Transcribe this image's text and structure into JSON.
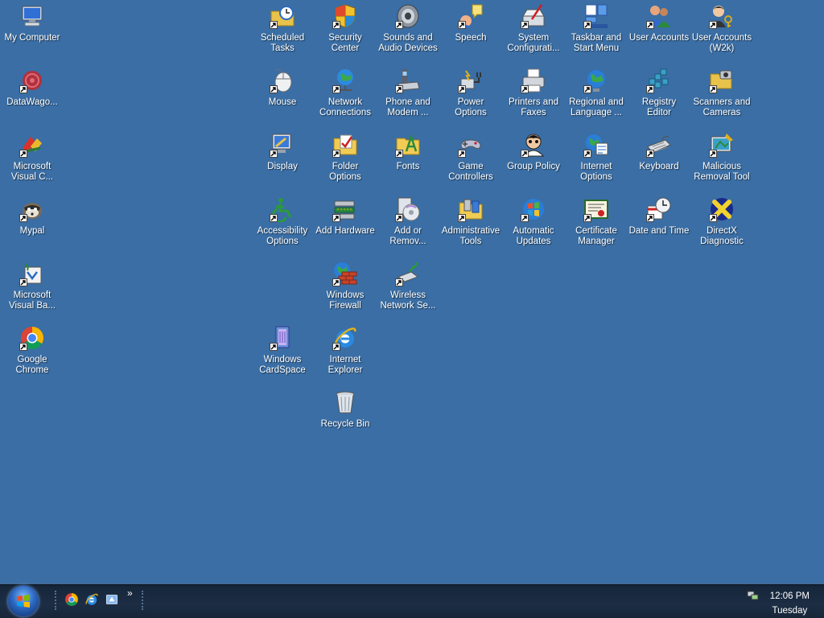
{
  "desktop_icons": [
    {
      "label": "My Computer",
      "icon": "computer-icon",
      "shortcut": false
    },
    {
      "label": "DataWago...",
      "icon": "datawago-icon",
      "shortcut": true
    },
    {
      "label": "Microsoft\nVisual C...",
      "icon": "visual-c-icon",
      "shortcut": true
    },
    {
      "label": "Mypal",
      "icon": "mypal-icon",
      "shortcut": true
    },
    {
      "label": "Microsoft\nVisual Ba...",
      "icon": "visual-basic-icon",
      "shortcut": true
    },
    {
      "label": "Google\nChrome",
      "icon": "chrome-icon",
      "shortcut": true
    },
    {
      "label": "Scheduled\nTasks",
      "icon": "scheduled-tasks-icon",
      "shortcut": true
    },
    {
      "label": "Security\nCenter",
      "icon": "security-center-icon",
      "shortcut": true
    },
    {
      "label": "Sounds and\nAudio Devices",
      "icon": "sounds-icon",
      "shortcut": true
    },
    {
      "label": "Speech",
      "icon": "speech-icon",
      "shortcut": true
    },
    {
      "label": "System\nConfigurati...",
      "icon": "system-config-icon",
      "shortcut": true
    },
    {
      "label": "Taskbar and\nStart Menu",
      "icon": "taskbar-icon",
      "shortcut": true
    },
    {
      "label": "User Accounts",
      "icon": "user-accounts-icon",
      "shortcut": true
    },
    {
      "label": "User Accounts\n(W2k)",
      "icon": "user-accounts-w2k-icon",
      "shortcut": true
    },
    {
      "label": "Mouse",
      "icon": "mouse-icon",
      "shortcut": true
    },
    {
      "label": "Network\nConnections",
      "icon": "network-icon",
      "shortcut": true
    },
    {
      "label": "Phone and\nModem ...",
      "icon": "phone-modem-icon",
      "shortcut": true
    },
    {
      "label": "Power\nOptions",
      "icon": "power-icon",
      "shortcut": true
    },
    {
      "label": "Printers and\nFaxes",
      "icon": "printer-icon",
      "shortcut": true
    },
    {
      "label": "Regional and\nLanguage ...",
      "icon": "regional-icon",
      "shortcut": true
    },
    {
      "label": "Registry\nEditor",
      "icon": "registry-icon",
      "shortcut": true
    },
    {
      "label": "Scanners and\nCameras",
      "icon": "scanner-icon",
      "shortcut": true
    },
    {
      "label": "Display",
      "icon": "display-icon",
      "shortcut": true
    },
    {
      "label": "Folder\nOptions",
      "icon": "folder-options-icon",
      "shortcut": true
    },
    {
      "label": "Fonts",
      "icon": "fonts-icon",
      "shortcut": true
    },
    {
      "label": "Game\nControllers",
      "icon": "game-controller-icon",
      "shortcut": true
    },
    {
      "label": "Group Policy",
      "icon": "group-policy-icon",
      "shortcut": true
    },
    {
      "label": "Internet\nOptions",
      "icon": "internet-options-icon",
      "shortcut": true
    },
    {
      "label": "Keyboard",
      "icon": "keyboard-icon",
      "shortcut": true
    },
    {
      "label": "Malicious\nRemoval Tool",
      "icon": "malicious-removal-icon",
      "shortcut": true
    },
    {
      "label": "Accessibility\nOptions",
      "icon": "accessibility-icon",
      "shortcut": true
    },
    {
      "label": "Add Hardware",
      "icon": "add-hardware-icon",
      "shortcut": true
    },
    {
      "label": "Add or\nRemov...",
      "icon": "add-remove-icon",
      "shortcut": true
    },
    {
      "label": "Administrative\nTools",
      "icon": "admin-tools-icon",
      "shortcut": true
    },
    {
      "label": "Automatic\nUpdates",
      "icon": "auto-updates-icon",
      "shortcut": true
    },
    {
      "label": "Certificate\nManager",
      "icon": "certificate-icon",
      "shortcut": true
    },
    {
      "label": "Date and Time",
      "icon": "date-time-icon",
      "shortcut": true
    },
    {
      "label": "DirectX\nDiagnostic",
      "icon": "directx-icon",
      "shortcut": true
    },
    {
      "label": "Windows\nFirewall",
      "icon": "firewall-icon",
      "shortcut": true
    },
    {
      "label": "Wireless\nNetwork Se...",
      "icon": "wireless-icon",
      "shortcut": true
    },
    {
      "label": "Windows\nCardSpace",
      "icon": "cardspace-icon",
      "shortcut": true
    },
    {
      "label": "Internet\nExplorer",
      "icon": "ie-icon",
      "shortcut": true
    },
    {
      "label": "Recycle Bin",
      "icon": "recycle-bin-icon",
      "shortcut": false
    }
  ],
  "taskbar": {
    "quick_launch": [
      "chrome-icon",
      "ie-icon",
      "show-desktop-icon"
    ],
    "overflow": "»",
    "clock_time": "12:06 PM",
    "clock_day": "Tuesday"
  },
  "colors": {
    "desktop": "#3a6ea5",
    "taskbar": "#1c2d44"
  }
}
